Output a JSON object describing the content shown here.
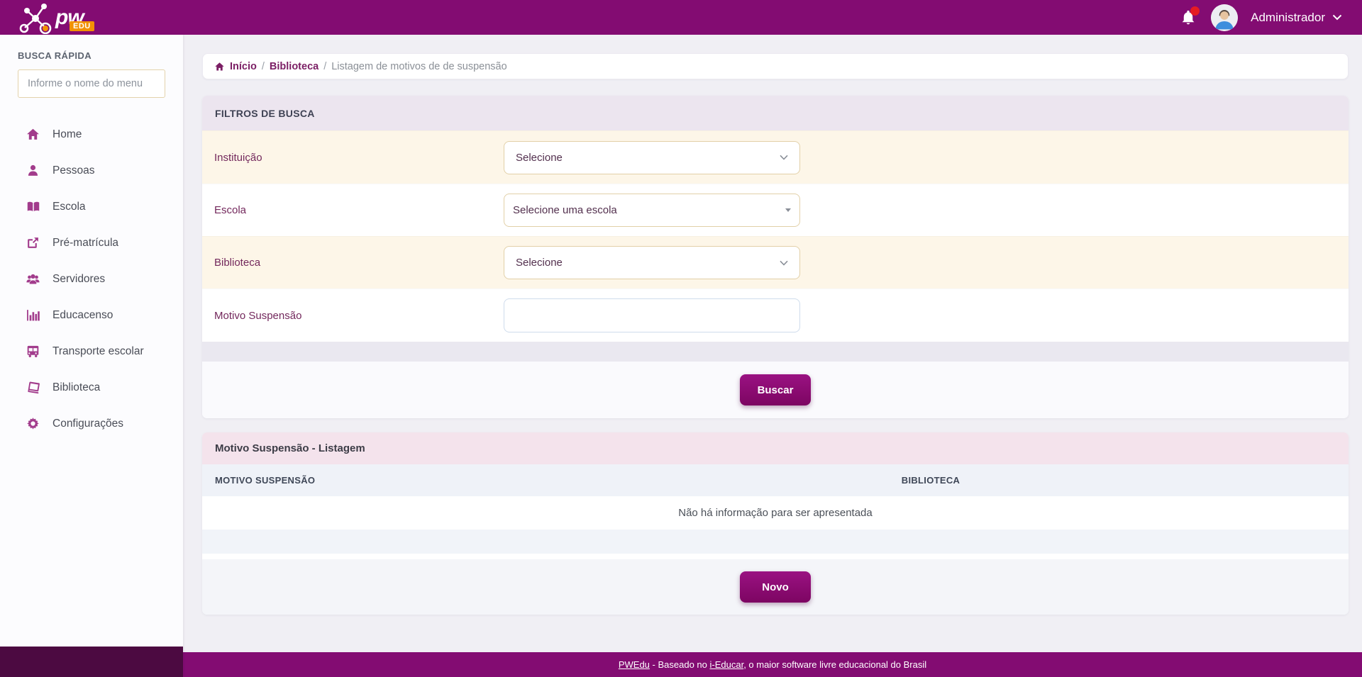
{
  "header": {
    "brand_name": "pw",
    "brand_sub": "EDU",
    "user_name": "Administrador"
  },
  "sidebar": {
    "quick_search_label": "BUSCA RÁPIDA",
    "search_placeholder": "Informe o nome do menu",
    "items": [
      {
        "label": "Home",
        "icon": "home-icon"
      },
      {
        "label": "Pessoas",
        "icon": "person-icon"
      },
      {
        "label": "Escola",
        "icon": "open-book-icon"
      },
      {
        "label": "Pré-matrícula",
        "icon": "share-icon"
      },
      {
        "label": "Servidores",
        "icon": "users-icon"
      },
      {
        "label": "Educacenso",
        "icon": "bar-chart-icon"
      },
      {
        "label": "Transporte escolar",
        "icon": "bus-icon"
      },
      {
        "label": "Biblioteca",
        "icon": "book-icon"
      },
      {
        "label": "Configurações",
        "icon": "gear-icon"
      }
    ]
  },
  "breadcrumb": {
    "separator": "/",
    "items": [
      {
        "label": "Início"
      },
      {
        "label": "Biblioteca"
      },
      {
        "label": "Listagem de motivos de de suspensão"
      }
    ]
  },
  "filters": {
    "title": "FILTROS DE BUSCA",
    "fields": [
      {
        "label": "Instituição",
        "type": "select",
        "value": "Selecione"
      },
      {
        "label": "Escola",
        "type": "select",
        "value": "Selecione uma escola"
      },
      {
        "label": "Biblioteca",
        "type": "select",
        "value": "Selecione"
      },
      {
        "label": "Motivo Suspensão",
        "type": "text",
        "value": ""
      }
    ],
    "search_button": "Buscar"
  },
  "listing": {
    "title": "Motivo Suspensão - Listagem",
    "columns": [
      "MOTIVO SUSPENSÃO",
      "BIBLIOTECA"
    ],
    "empty_message": "Não há informação para ser apresentada",
    "new_button": "Novo"
  },
  "footer": {
    "brand_link": "PWEdu",
    "text_middle": " - Baseado no ",
    "educar_link": "i-Educar",
    "text_after": ", o maior software livre educacional do Brasil"
  },
  "colors": {
    "primary_purple": "#830c72",
    "button_purple": "#8c0d72",
    "accent_orange": "#f29104",
    "notification_red": "#e51c23",
    "cream_row": "#fdf6e8",
    "lavender_header": "#ece5ef",
    "pink_header": "#f4e3ec"
  }
}
